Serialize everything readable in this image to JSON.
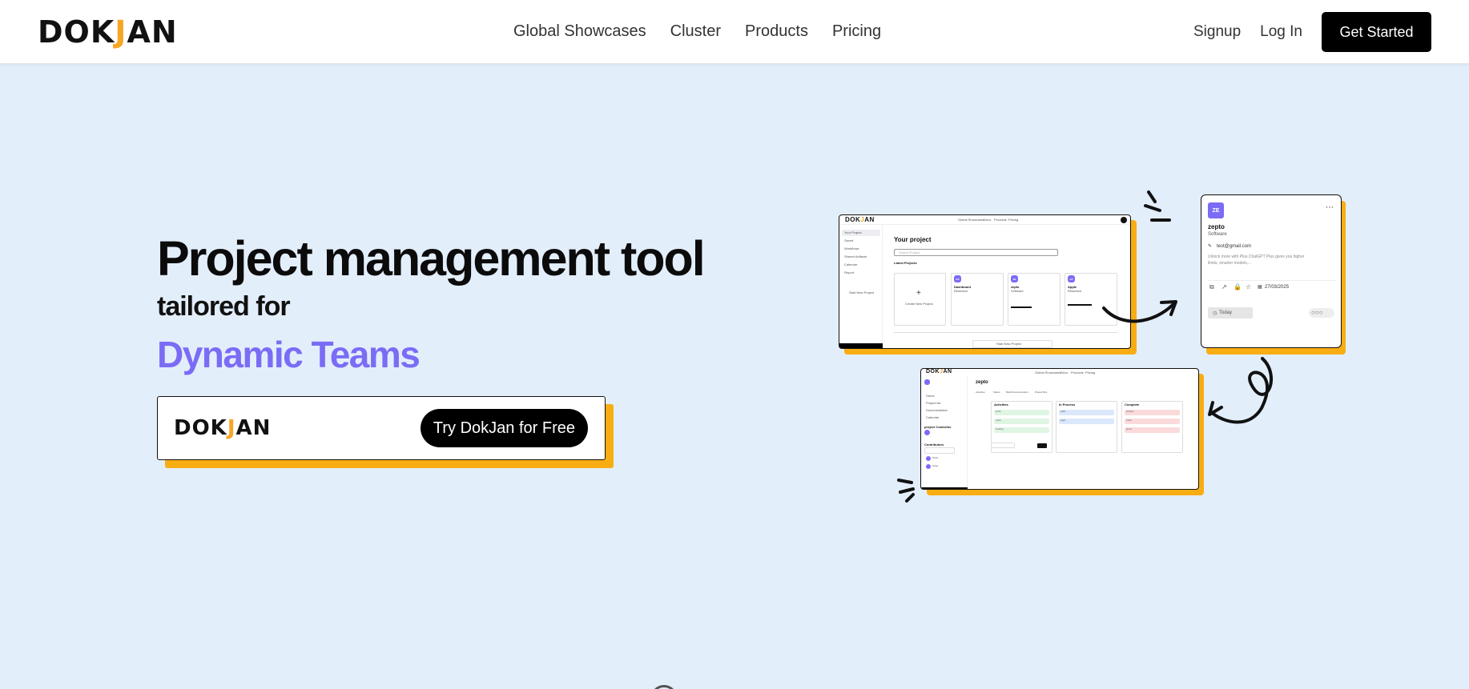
{
  "brand": {
    "logo_pre": "DOK",
    "logo_j": "J",
    "logo_post": "AN"
  },
  "nav": {
    "links": [
      "Global Showcases",
      "Cluster",
      "Products",
      "Pricing"
    ],
    "signup": "Signup",
    "login": "Log In",
    "cta": "Get Started"
  },
  "hero": {
    "title": "Project management tool",
    "subtitle": "tailored for",
    "accent": "Dynamic Teams",
    "cta_button": "Try DokJan for Free"
  },
  "preview_dashboard": {
    "heading": "Your project",
    "search_placeholder": "Search Project",
    "section": "Latest Projects",
    "create_label": "Create New Project",
    "sidebar": [
      "Your Project",
      "Saved",
      "Workflows",
      "Shared Artifacts",
      "Calendar",
      "Report"
    ],
    "sidebar_cta": "Start New Project",
    "projects": [
      {
        "initials": "DS",
        "name": "Dashboard",
        "type": "Research"
      },
      {
        "initials": "ZE",
        "name": "zepto",
        "type": "Software"
      },
      {
        "initials": "AP",
        "name": "Apple",
        "type": "Research"
      }
    ],
    "footer_btn": "Start New Project",
    "nav_links": [
      "Global Showcases",
      "Deco",
      "Products",
      "Pricing"
    ]
  },
  "preview_card": {
    "initials": "ZE",
    "name": "zepto",
    "type": "Software",
    "email": "test@gmail.com",
    "description_line1": "Unlock more with Plus ChatGPT Plus gives you higher",
    "description_line2": "limits, smarter models,...",
    "date": "27/03/2025",
    "tag": "Today"
  },
  "preview_board": {
    "title": "zepto",
    "tabs": [
      "Activities",
      "Status",
      "Build Documentation",
      "Project Box"
    ],
    "columns": [
      {
        "name": "Activities",
        "items": [
          "work",
          "more",
          "Coding"
        ],
        "color": "#dff5e3"
      },
      {
        "name": "In Process",
        "items": [
          "Addr",
          "login"
        ],
        "color": "#dbe8fb"
      },
      {
        "name": "Complete",
        "items": [
          "version",
          "more",
          "send"
        ],
        "color": "#fadada"
      }
    ],
    "sidebar": [
      "Home",
      "Project list",
      "Documentation",
      "Calendar"
    ],
    "project_label": "project Controller",
    "contributors_label": "Contributors",
    "contributors": [
      "Test2",
      "tester"
    ]
  },
  "colors": {
    "accent": "#7b6cf6",
    "shadow": "#f8ad12",
    "background": "#e3eefb"
  }
}
